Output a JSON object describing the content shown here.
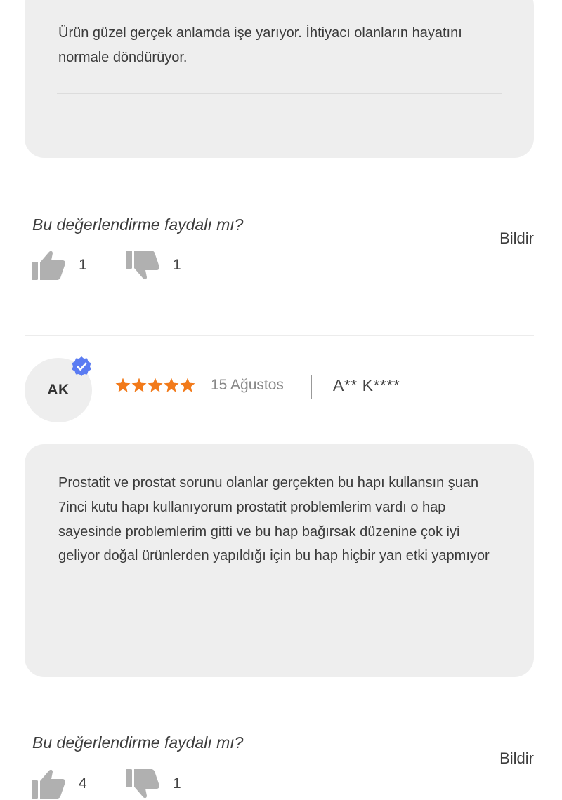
{
  "reviews": [
    {
      "text": "Ürün güzel gerçek anlamda işe yarıyor. İhtiyacı olanların hayatını normale döndürüyor.",
      "helpful_question": "Bu değerlendirme faydalı mı?",
      "report_label": "Bildir",
      "likes": "1",
      "dislikes": "1"
    },
    {
      "initials": "AK",
      "verified": true,
      "rating": 5,
      "date": "15 Ağustos",
      "reviewer": "A** K****",
      "text": "Prostatit ve prostat sorunu olanlar gerçekten bu hapı kullansın şuan 7inci kutu hapı kullanıyorum prostatit problemlerim vardı o hap sayesinde problemlerim gitti ve bu hap bağırsak düzenine çok iyi geliyor doğal ürünlerden yapıldığı için bu hap hiçbir yan etki yapmıyor",
      "helpful_question": "Bu değerlendirme faydalı mı?",
      "report_label": "Bildir",
      "likes": "4",
      "dislikes": "1"
    }
  ],
  "colors": {
    "card_background": "#eeeeee",
    "star": "#f27a1a",
    "verified_badge": "#5b7cf2",
    "icon_gray": "#b0b0b0"
  },
  "icons": {
    "like": "thumbs-up-icon",
    "dislike": "thumbs-down-icon",
    "verified": "verified-badge-icon",
    "star": "star-icon"
  }
}
